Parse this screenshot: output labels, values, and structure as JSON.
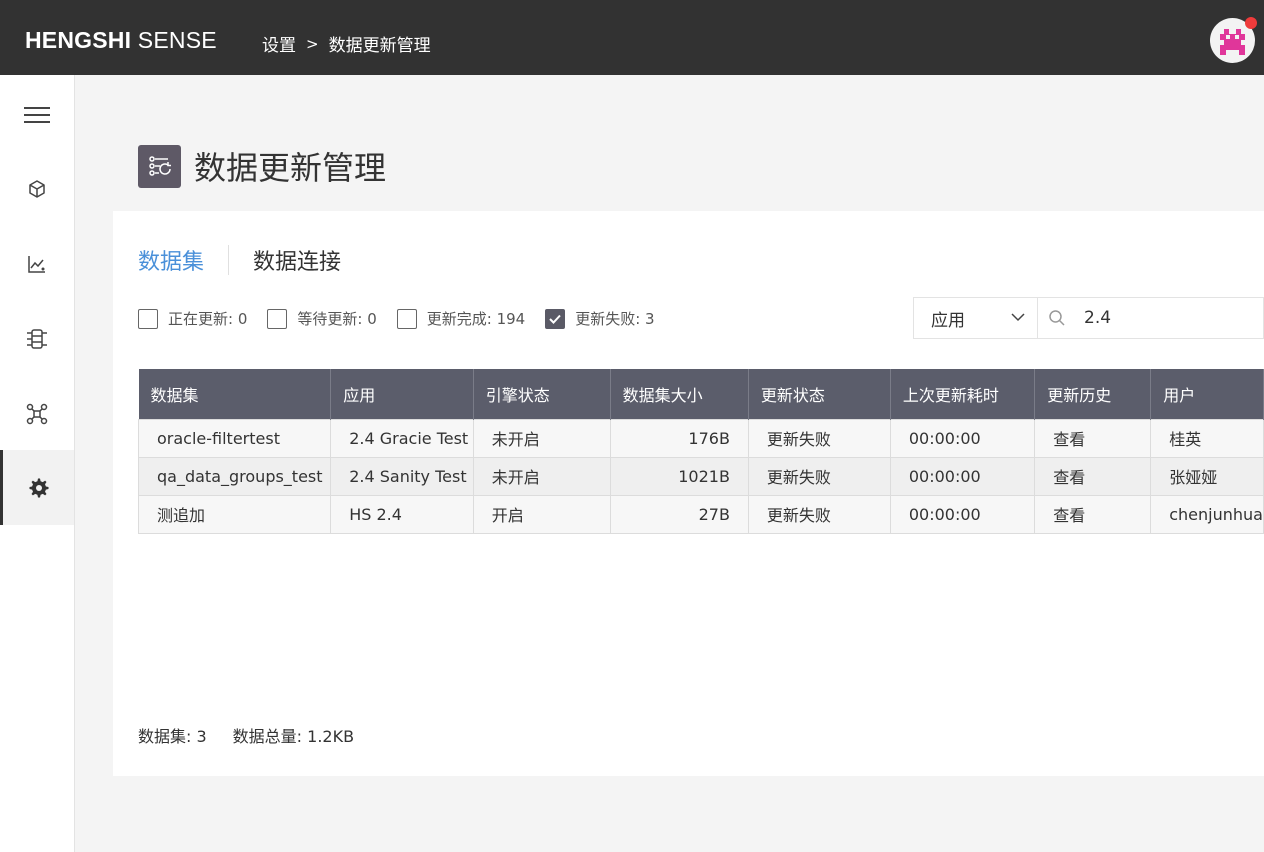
{
  "app": {
    "brand_bold": "HENGSHI",
    "brand_light": "SENSE"
  },
  "breadcrumb": {
    "items": [
      "设置",
      "数据更新管理"
    ],
    "separator": ">"
  },
  "colors": {
    "topbar": "#323232",
    "accent_tab": "#4a90d9",
    "table_header": "#5b5d6b",
    "avatar_icon": "#e0369a",
    "notification": "#ef3b3b"
  },
  "sidebar": {
    "items": [
      {
        "icon": "menu-icon"
      },
      {
        "icon": "cube-icon"
      },
      {
        "icon": "chart-icon"
      },
      {
        "icon": "dataset-icon"
      },
      {
        "icon": "network-icon"
      },
      {
        "icon": "gear-icon",
        "active": true
      }
    ]
  },
  "page": {
    "title": "数据更新管理"
  },
  "tabs": [
    {
      "label": "数据集",
      "active": true
    },
    {
      "label": "数据连接",
      "active": false
    }
  ],
  "filters": [
    {
      "label": "正在更新: 0",
      "checked": false
    },
    {
      "label": "等待更新: 0",
      "checked": false
    },
    {
      "label": "更新完成: 194",
      "checked": false
    },
    {
      "label": "更新失败: 3",
      "checked": true
    }
  ],
  "select": {
    "value": "应用"
  },
  "search": {
    "value": "2.4"
  },
  "table": {
    "headers": [
      "数据集",
      "应用",
      "引擎状态",
      "数据集大小",
      "更新状态",
      "上次更新耗时",
      "更新历史",
      "用户"
    ],
    "rows": [
      [
        "oracle-filtertest",
        "2.4 Gracie Test",
        "未开启",
        "176B",
        "更新失败",
        "00:00:00",
        "查看",
        "桂英"
      ],
      [
        "qa_data_groups_test",
        "2.4 Sanity Test",
        "未开启",
        "1021B",
        "更新失败",
        "00:00:00",
        "查看",
        "张娅娅"
      ],
      [
        "测追加",
        "HS 2.4",
        "开启",
        "27B",
        "更新失败",
        "00:00:00",
        "查看",
        "chenjunhua"
      ]
    ]
  },
  "footer": {
    "dataset_count": "数据集: 3",
    "data_total": "数据总量: 1.2KB"
  }
}
